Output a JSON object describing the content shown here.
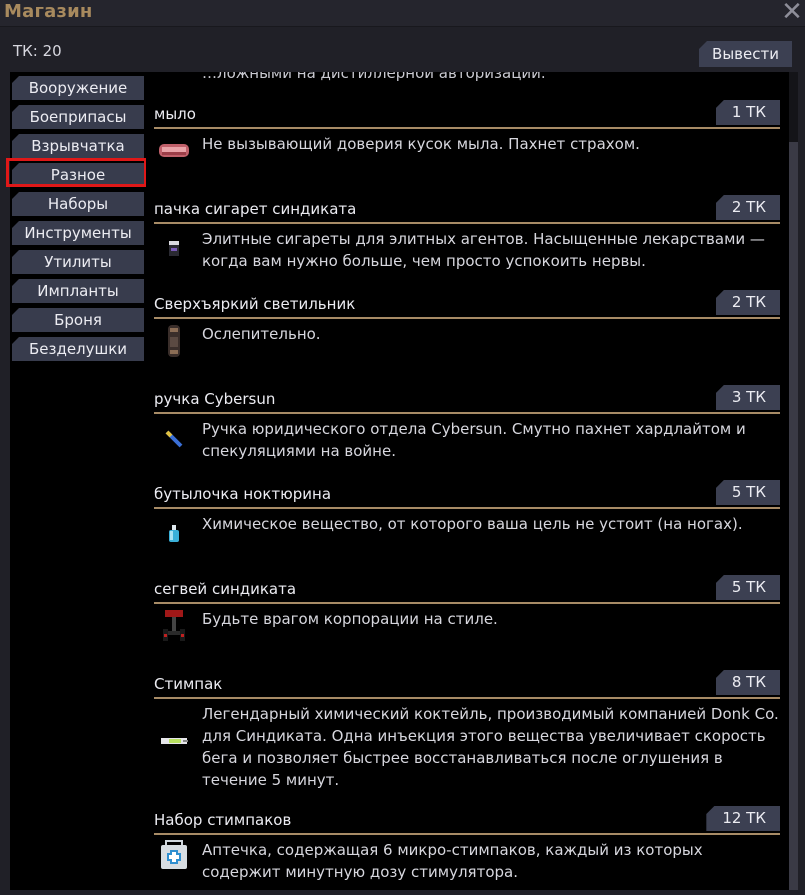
{
  "window": {
    "title": "Магазин",
    "close_icon": "close-icon"
  },
  "balance": "ТК: 20",
  "withdraw_label": "Вывести",
  "sidebar": {
    "selected": "Разное",
    "items": [
      {
        "label": "Вооружение"
      },
      {
        "label": "Боеприпасы"
      },
      {
        "label": "Взрывчатка"
      },
      {
        "label": "Разное"
      },
      {
        "label": "Наборы"
      },
      {
        "label": "Инструменты"
      },
      {
        "label": "Утилиты"
      },
      {
        "label": "Импланты"
      },
      {
        "label": "Броня"
      },
      {
        "label": "Безделушки"
      }
    ]
  },
  "cut_text": "…ложными на дистиллерной авторизации.",
  "items": [
    {
      "name": "мыло",
      "price": "1 ТК",
      "icon": "soap-icon",
      "desc": "Не вызывающий доверия кусок мыла. Пахнет страхом."
    },
    {
      "name": "пачка сигарет синдиката",
      "price": "2 ТК",
      "icon": "cigarette-pack-icon",
      "desc": "Элитные сигареты для элитных агентов. Насыщенные лекарствами — когда вам нужно больше, чем просто успокоить нервы."
    },
    {
      "name": "Сверхъяркий светильник",
      "price": "2 ТК",
      "icon": "flashlight-icon",
      "desc": "Ослепительно."
    },
    {
      "name": "ручка Cybersun",
      "price": "3 ТК",
      "icon": "pen-icon",
      "desc": "Ручка юридического отдела Cybersun. Смутно пахнет хардлайтом и спекуляциями на войне."
    },
    {
      "name": "бутылочка ноктюрина",
      "price": "5 ТК",
      "icon": "bottle-icon",
      "desc": "Химическое вещество, от которого ваша цель не устоит (на ногах)."
    },
    {
      "name": "сегвей синдиката",
      "price": "5 ТК",
      "icon": "segway-icon",
      "desc": "Будьте врагом корпорации на стиле."
    },
    {
      "name": "Стимпак",
      "price": "8 ТК",
      "icon": "stimpack-icon",
      "desc": "Легендарный химический коктейль, производимый компанией Donk Co. для Синдиката. Одна инъекция этого вещества увеличивает скорость бега и позволяет быстрее восстанавливаться после оглушения в течение 5 минут."
    },
    {
      "name": "Набор стимпаков",
      "price": "12 ТК",
      "icon": "medkit-icon",
      "desc": "Аптечка, содержащая 6 микро-стимпаков, каждый из которых содержит минутную дозу стимулятора."
    }
  ]
}
